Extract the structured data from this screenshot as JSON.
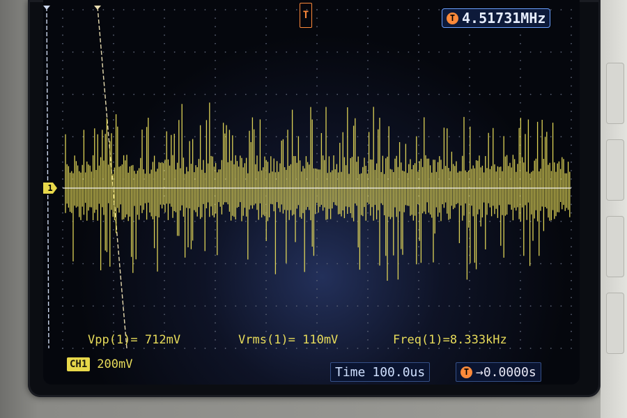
{
  "display": {
    "frequency_readout": "4.51731MHz",
    "trigger_marker": "T",
    "channel_marker": "1",
    "measurements": {
      "vpp": "Vpp(1)= 712mV",
      "vrms": "Vrms(1)= 110mV",
      "freq": "Freq(1)=8.333kHz"
    },
    "channel_label": "CH1",
    "volts_per_div": "200mV",
    "time_label": "Time",
    "time_per_div": "100.0us",
    "trigger_offset": "→0.0000s"
  },
  "colors": {
    "trace": "#e8dc5a",
    "accent": "#ff8a3a",
    "readout": "#e7eeff",
    "screen_bg": "#05070d"
  },
  "icons": {
    "trigger": "t-circle-icon"
  }
}
